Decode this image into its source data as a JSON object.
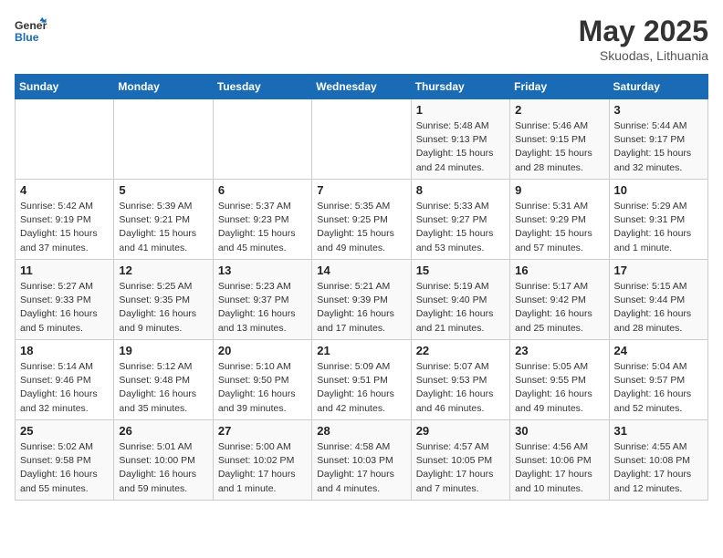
{
  "header": {
    "logo_general": "General",
    "logo_blue": "Blue",
    "title": "May 2025",
    "subtitle": "Skuodas, Lithuania"
  },
  "weekdays": [
    "Sunday",
    "Monday",
    "Tuesday",
    "Wednesday",
    "Thursday",
    "Friday",
    "Saturday"
  ],
  "weeks": [
    [
      {
        "day": "",
        "info": ""
      },
      {
        "day": "",
        "info": ""
      },
      {
        "day": "",
        "info": ""
      },
      {
        "day": "",
        "info": ""
      },
      {
        "day": "1",
        "info": "Sunrise: 5:48 AM\nSunset: 9:13 PM\nDaylight: 15 hours\nand 24 minutes."
      },
      {
        "day": "2",
        "info": "Sunrise: 5:46 AM\nSunset: 9:15 PM\nDaylight: 15 hours\nand 28 minutes."
      },
      {
        "day": "3",
        "info": "Sunrise: 5:44 AM\nSunset: 9:17 PM\nDaylight: 15 hours\nand 32 minutes."
      }
    ],
    [
      {
        "day": "4",
        "info": "Sunrise: 5:42 AM\nSunset: 9:19 PM\nDaylight: 15 hours\nand 37 minutes."
      },
      {
        "day": "5",
        "info": "Sunrise: 5:39 AM\nSunset: 9:21 PM\nDaylight: 15 hours\nand 41 minutes."
      },
      {
        "day": "6",
        "info": "Sunrise: 5:37 AM\nSunset: 9:23 PM\nDaylight: 15 hours\nand 45 minutes."
      },
      {
        "day": "7",
        "info": "Sunrise: 5:35 AM\nSunset: 9:25 PM\nDaylight: 15 hours\nand 49 minutes."
      },
      {
        "day": "8",
        "info": "Sunrise: 5:33 AM\nSunset: 9:27 PM\nDaylight: 15 hours\nand 53 minutes."
      },
      {
        "day": "9",
        "info": "Sunrise: 5:31 AM\nSunset: 9:29 PM\nDaylight: 15 hours\nand 57 minutes."
      },
      {
        "day": "10",
        "info": "Sunrise: 5:29 AM\nSunset: 9:31 PM\nDaylight: 16 hours\nand 1 minute."
      }
    ],
    [
      {
        "day": "11",
        "info": "Sunrise: 5:27 AM\nSunset: 9:33 PM\nDaylight: 16 hours\nand 5 minutes."
      },
      {
        "day": "12",
        "info": "Sunrise: 5:25 AM\nSunset: 9:35 PM\nDaylight: 16 hours\nand 9 minutes."
      },
      {
        "day": "13",
        "info": "Sunrise: 5:23 AM\nSunset: 9:37 PM\nDaylight: 16 hours\nand 13 minutes."
      },
      {
        "day": "14",
        "info": "Sunrise: 5:21 AM\nSunset: 9:39 PM\nDaylight: 16 hours\nand 17 minutes."
      },
      {
        "day": "15",
        "info": "Sunrise: 5:19 AM\nSunset: 9:40 PM\nDaylight: 16 hours\nand 21 minutes."
      },
      {
        "day": "16",
        "info": "Sunrise: 5:17 AM\nSunset: 9:42 PM\nDaylight: 16 hours\nand 25 minutes."
      },
      {
        "day": "17",
        "info": "Sunrise: 5:15 AM\nSunset: 9:44 PM\nDaylight: 16 hours\nand 28 minutes."
      }
    ],
    [
      {
        "day": "18",
        "info": "Sunrise: 5:14 AM\nSunset: 9:46 PM\nDaylight: 16 hours\nand 32 minutes."
      },
      {
        "day": "19",
        "info": "Sunrise: 5:12 AM\nSunset: 9:48 PM\nDaylight: 16 hours\nand 35 minutes."
      },
      {
        "day": "20",
        "info": "Sunrise: 5:10 AM\nSunset: 9:50 PM\nDaylight: 16 hours\nand 39 minutes."
      },
      {
        "day": "21",
        "info": "Sunrise: 5:09 AM\nSunset: 9:51 PM\nDaylight: 16 hours\nand 42 minutes."
      },
      {
        "day": "22",
        "info": "Sunrise: 5:07 AM\nSunset: 9:53 PM\nDaylight: 16 hours\nand 46 minutes."
      },
      {
        "day": "23",
        "info": "Sunrise: 5:05 AM\nSunset: 9:55 PM\nDaylight: 16 hours\nand 49 minutes."
      },
      {
        "day": "24",
        "info": "Sunrise: 5:04 AM\nSunset: 9:57 PM\nDaylight: 16 hours\nand 52 minutes."
      }
    ],
    [
      {
        "day": "25",
        "info": "Sunrise: 5:02 AM\nSunset: 9:58 PM\nDaylight: 16 hours\nand 55 minutes."
      },
      {
        "day": "26",
        "info": "Sunrise: 5:01 AM\nSunset: 10:00 PM\nDaylight: 16 hours\nand 59 minutes."
      },
      {
        "day": "27",
        "info": "Sunrise: 5:00 AM\nSunset: 10:02 PM\nDaylight: 17 hours\nand 1 minute."
      },
      {
        "day": "28",
        "info": "Sunrise: 4:58 AM\nSunset: 10:03 PM\nDaylight: 17 hours\nand 4 minutes."
      },
      {
        "day": "29",
        "info": "Sunrise: 4:57 AM\nSunset: 10:05 PM\nDaylight: 17 hours\nand 7 minutes."
      },
      {
        "day": "30",
        "info": "Sunrise: 4:56 AM\nSunset: 10:06 PM\nDaylight: 17 hours\nand 10 minutes."
      },
      {
        "day": "31",
        "info": "Sunrise: 4:55 AM\nSunset: 10:08 PM\nDaylight: 17 hours\nand 12 minutes."
      }
    ]
  ]
}
